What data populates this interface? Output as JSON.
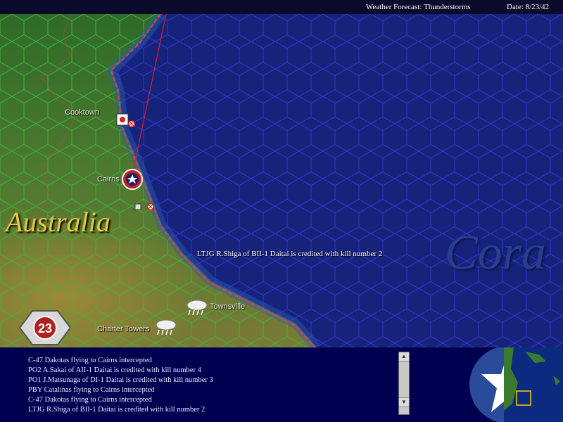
{
  "topbar": {
    "weather": "Weather Forecast: Thunderstorms",
    "date": "Date: 8/23/42"
  },
  "map": {
    "region_label": "Australia",
    "sea_label": "Cora",
    "towns": {
      "cooktown": "Cooktown",
      "cairns": "Cairns",
      "townsville": "Townsville",
      "charter_towers": "Charter Towers"
    },
    "combat_message": "LTJG R.Shiga of BII-1 Daitai is credited with kill number 2",
    "unit_badge": "23",
    "colors": {
      "land_hex": "#3aa13a",
      "sea_hex": "#3a3ae6",
      "coast_border": "#e03030",
      "sea": "#16237a"
    }
  },
  "log": {
    "messages": [
      "C-47 Dakotas flying to Cairns intercepted",
      "PO2 A.Sakai of AII-1 Daitai is credited with kill number 4",
      "PO1 J.Matsunaga of DI-1 Daitai is credited with kill number 3",
      "PBY Catalinas flying to Cairns intercepted",
      "C-47 Dakotas flying to Cairns intercepted",
      "LTJG R.Shiga of BII-1 Daitai is credited with kill number 2"
    ]
  }
}
